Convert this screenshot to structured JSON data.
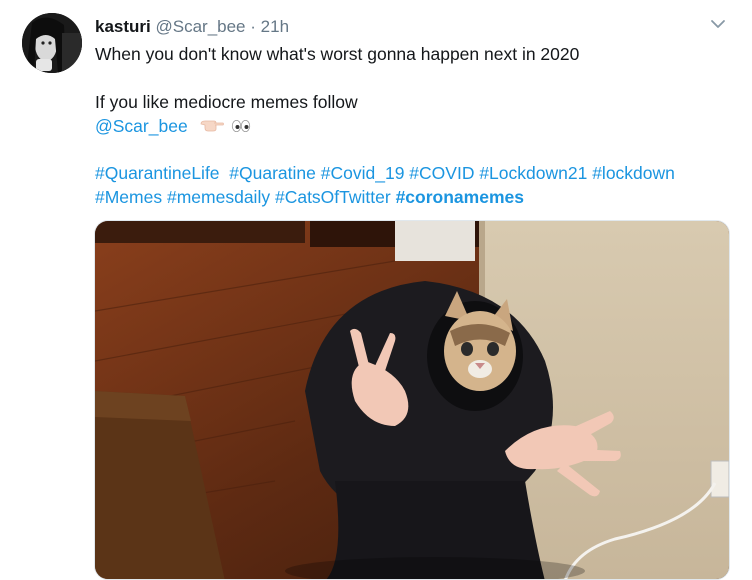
{
  "tweet": {
    "display_name": "kasturi",
    "handle": "@Scar_bee",
    "separator": "·",
    "timestamp": "21h",
    "line1": "When you don't know what's worst gonna happen next in 2020",
    "line2": "If you like mediocre memes follow",
    "mention": "@Scar_bee",
    "hashtags_row1": [
      "#QuarantineLife",
      "#Quaratine",
      "#Covid_19",
      "#COVID",
      "#Lockdown21",
      "#lockdown"
    ],
    "hashtags_row2": [
      "#Memes",
      "#memesdaily",
      "#CatsOfTwitter"
    ],
    "hashtag_bold": "#coronamemes"
  },
  "icons": {
    "menu": "chevron-down-icon",
    "emoji1": "pointing-left-hand-emoji",
    "emoji2": "eyes-emoji"
  },
  "colors": {
    "link": "#1b95e0",
    "secondary_text": "#657786",
    "primary_text": "#14171a"
  }
}
